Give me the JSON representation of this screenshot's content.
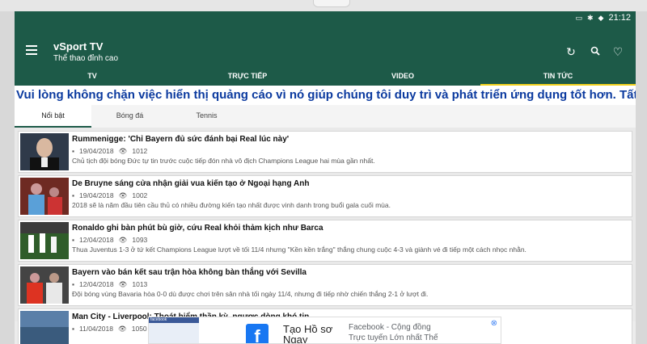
{
  "statusbar": {
    "time": "21:12",
    "icons": [
      "cast-icon",
      "bluetooth-icon",
      "wifi-icon"
    ]
  },
  "appbar": {
    "title": "vSport TV",
    "subtitle": "Thể thao đỉnh cao",
    "actions": [
      "refresh-icon",
      "search-icon",
      "heart-icon"
    ]
  },
  "tabs": [
    {
      "label": "TV",
      "active": false
    },
    {
      "label": "TRỰC TIẾP",
      "active": false
    },
    {
      "label": "VIDEO",
      "active": false
    },
    {
      "label": "TIN TỨC",
      "active": true
    }
  ],
  "marquee": "Vui lòng không chặn việc hiển thị quảng cáo vì nó giúp chúng tôi duy trì và phát triển ứng dụng tốt hơn. Tất cả thiết bị cá",
  "subtabs": [
    {
      "label": "Nổi bật",
      "active": true
    },
    {
      "label": "Bóng đá",
      "active": false
    },
    {
      "label": "Tennis",
      "active": false
    }
  ],
  "articles": [
    {
      "title": "Rummenigge: 'Chỉ Bayern đủ sức đánh bại Real lúc này'",
      "date": "19/04/2018",
      "views": "1012",
      "desc": "Chủ tịch đội bóng Đức tự tin trước cuộc tiếp đón nhà vô địch Champions League hai mùa gần nhất."
    },
    {
      "title": "De Bruyne sáng cửa nhận giải vua kiến tạo ở Ngoại hạng Anh",
      "date": "19/04/2018",
      "views": "1002",
      "desc": "2018 sẽ là năm đầu tiên cầu thủ có nhiều đường kiến tạo nhất được vinh danh trong buổi gala cuối mùa."
    },
    {
      "title": "Ronaldo ghi bàn phút bù giờ, cứu Real khỏi thảm kịch như Barca",
      "date": "12/04/2018",
      "views": "1093",
      "desc": "Thua Juventus 1-3 ở tứ kết Champions League lượt về tối 11/4 nhưng \"Kền kền trắng\" thắng chung cuộc 4-3 và giành vé đi tiếp một cách nhọc nhằn."
    },
    {
      "title": "Bayern vào bán kết sau trận hòa không bàn thắng với Sevilla",
      "date": "12/04/2018",
      "views": "1013",
      "desc": "Đội bóng vùng Bavaria hòa 0-0 dù được chơi trên sân nhà tối ngày 11/4, nhưng đi tiếp nhờ chiến thắng 2-1 ở lượt đi."
    },
    {
      "title": "Man City - Liverpool: Thoát hiểm thần kỳ, ngược dòng khó tin",
      "date": "11/04/2018",
      "views": "1050",
      "desc": ""
    }
  ],
  "ad": {
    "screenshot_label": "facebook",
    "title": "Tạo Hồ sơ Ngay",
    "line1": "Facebook - Cộng đồng",
    "line2": "Trực tuyến Lớn nhất Thế",
    "close": "⊗"
  },
  "colors": {
    "primary": "#1d5a48",
    "tab_indicator": "#f3d11d",
    "marquee_text": "#0b3a9f"
  }
}
